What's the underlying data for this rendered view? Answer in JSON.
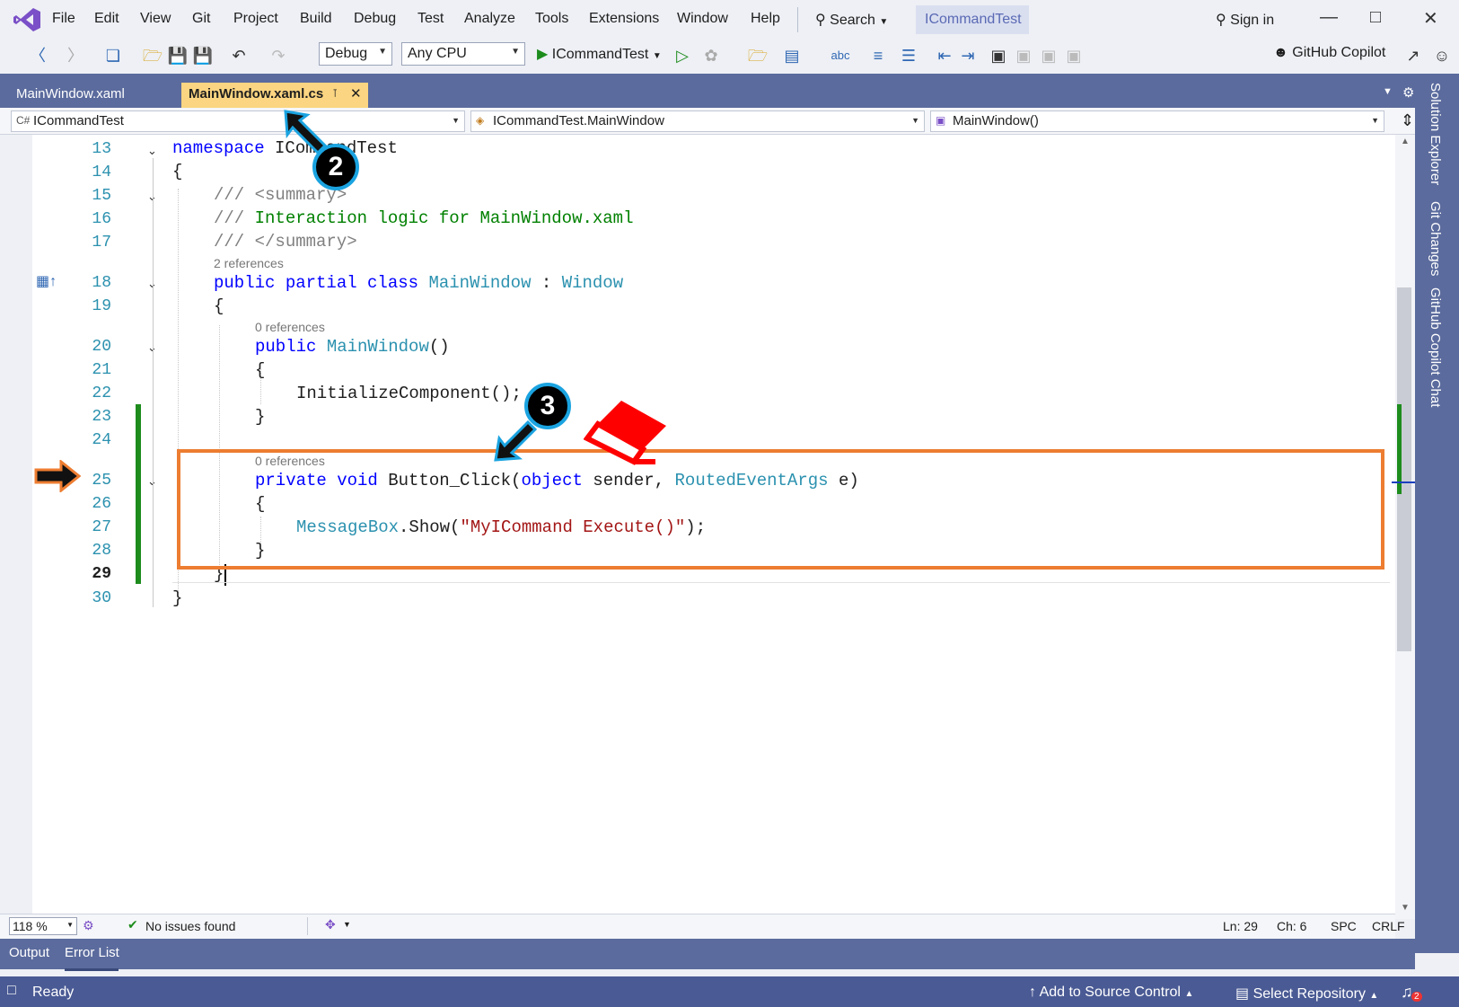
{
  "menu": {
    "items": [
      "File",
      "Edit",
      "View",
      "Git",
      "Project",
      "Build",
      "Debug",
      "Test",
      "Analyze",
      "Tools",
      "Extensions",
      "Window",
      "Help"
    ],
    "search_label": "Search",
    "project_title": "ICommandTest",
    "sign_in": "Sign in"
  },
  "toolbar": {
    "config": "Debug",
    "platform": "Any CPU",
    "run_target": "ICommandTest",
    "copilot": "GitHub Copilot"
  },
  "tabs": [
    {
      "label": "MainWindow.xaml",
      "active": false
    },
    {
      "label": "MainWindow.xaml.cs",
      "active": true
    }
  ],
  "nav": {
    "project": "ICommandTest",
    "type": "ICommandTest.MainWindow",
    "member": "MainWindow()"
  },
  "side_tabs": [
    "Solution Explorer",
    "Git Changes",
    "GitHub Copilot Chat"
  ],
  "code": {
    "line_numbers": [
      "13",
      "14",
      "15",
      "16",
      "17",
      "18",
      "19",
      "20",
      "21",
      "22",
      "23",
      "24",
      "25",
      "26",
      "27",
      "28",
      "29",
      "30"
    ],
    "codelens_2": "2 references",
    "codelens_0a": "0 references",
    "codelens_0b": "0 references",
    "l13_kw": "namespace",
    "l13_name": "ICommandTest",
    "l14": "{",
    "l15": "/// <summary>",
    "l16_a": "///",
    "l16_b": " Interaction logic for MainWindow.xaml",
    "l17": "/// </summary>",
    "l18_kw": "public partial class",
    "l18_type": "MainWindow",
    "l18_sep": " : ",
    "l18_base": "Window",
    "l19": "{",
    "l20_kw": "public",
    "l20_type": "MainWindow",
    "l20_rest": "()",
    "l21": "{",
    "l22": "InitializeComponent();",
    "l23": "}",
    "l25_kw": "private void",
    "l25_name": " Button_Click(",
    "l25_kw2": "object",
    "l25_mid": " sender, ",
    "l25_type": "RoutedEventArgs",
    "l25_end": " e)",
    "l26": "{",
    "l27_type": "MessageBox",
    "l27_mid": ".Show(",
    "l27_str": "\"MyICommand Execute()\"",
    "l27_end": ");",
    "l28": "}",
    "l29": "}",
    "l30": "}"
  },
  "editor_status": {
    "zoom": "118 %",
    "issues": "No issues found",
    "ln": "Ln: 29",
    "ch": "Ch: 6",
    "spc": "SPC",
    "crlf": "CRLF"
  },
  "output_tabs": [
    "Output",
    "Error List"
  ],
  "statusbar": {
    "ready": "Ready",
    "add_source": "Add to Source Control",
    "select_repo": "Select Repository",
    "notif_count": "2"
  },
  "annotations": {
    "badge2": "2",
    "badge3": "3"
  },
  "colors": {
    "tab_active": "#fbd581",
    "accent": "#5b6b9d",
    "highlight_box": "#ed7d31",
    "badge_ring": "#1aa3e0",
    "eraser": "#ff0000"
  }
}
